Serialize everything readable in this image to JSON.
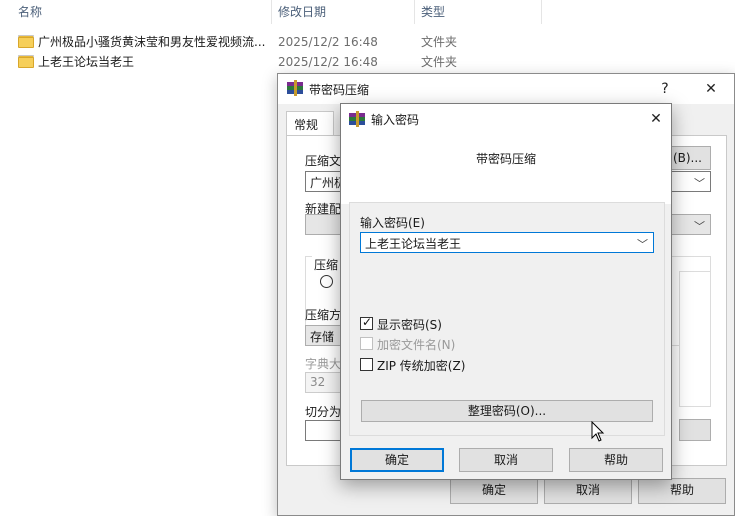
{
  "explorer": {
    "columns": [
      {
        "label": "名称"
      },
      {
        "label": "修改日期"
      },
      {
        "label": "类型"
      }
    ],
    "files": [
      {
        "name": "广州极品小骚货黄沫莹和男友性爱视频流...",
        "date": "2025/12/2 16:48",
        "type": "文件夹"
      },
      {
        "name": "上老王论坛当老王",
        "date": "2025/12/2 16:48",
        "type": "文件夹"
      }
    ]
  },
  "back_dialog": {
    "title": "带密码压缩",
    "help_glyph": "?",
    "close_glyph": "✕",
    "tab_general": "常规",
    "label_archive_name": "压缩文",
    "archive_name_value": "广州极",
    "browse_button": "(B)...",
    "label_profile": "新建配",
    "group_compress": "压缩",
    "label_method": "压缩方",
    "method_value": "存储",
    "label_dict": "字典大",
    "dict_value": "32",
    "label_split": "切分为",
    "ok_button": "确定",
    "cancel_button": "取消",
    "help_button": "帮助"
  },
  "password_dialog": {
    "title": "输入密码",
    "close_glyph": "✕",
    "header": "带密码压缩",
    "password_label": "输入密码(E)",
    "password_value": "上老王论坛当老王",
    "show_password_label": "显示密码(S)",
    "show_password_checked": true,
    "encrypt_names_label": "加密文件名(N)",
    "encrypt_names_checked": false,
    "zip_legacy_label": "ZIP 传统加密(Z)",
    "zip_legacy_checked": false,
    "organize_button": "整理密码(O)...",
    "ok_button": "确定",
    "cancel_button": "取消",
    "help_button": "帮助"
  }
}
